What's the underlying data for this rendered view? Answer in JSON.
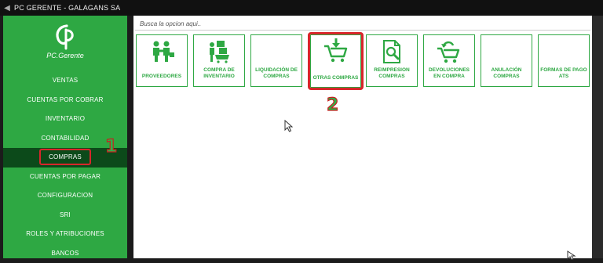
{
  "window": {
    "title": "PC GERENTE - GALAGANS SA"
  },
  "logo": {
    "text": "PC.Gerente"
  },
  "sidebar": {
    "items": [
      {
        "label": "VENTAS"
      },
      {
        "label": "CUENTAS POR COBRAR"
      },
      {
        "label": "INVENTARIO"
      },
      {
        "label": "CONTABILIDAD"
      },
      {
        "label": "COMPRAS"
      },
      {
        "label": "CUENTAS POR PAGAR"
      },
      {
        "label": "CONFIGURACION"
      },
      {
        "label": "SRI"
      },
      {
        "label": "ROLES Y ATRIBUCIONES"
      },
      {
        "label": "BANCOS"
      }
    ]
  },
  "search": {
    "placeholder": "Busca la opcion aqui.."
  },
  "tiles": [
    {
      "label": "PROVEEDORES",
      "icon": "suppliers-icon"
    },
    {
      "label": "COMPRA DE INVENTARIO",
      "icon": "inventory-purchase-icon"
    },
    {
      "label": "LIQUIDACIÓN DE COMPRAS",
      "icon": ""
    },
    {
      "label": "OTRAS COMPRAS",
      "icon": "shopping-cart-icon"
    },
    {
      "label": "REIMPRESION COMPRAS",
      "icon": "document-search-icon"
    },
    {
      "label": "DEVOLUCIONES EN COMPRA",
      "icon": "cart-return-icon"
    },
    {
      "label": "ANULACIÓN COMPRAS",
      "icon": ""
    },
    {
      "label": "FORMAS DE PAGO ATS",
      "icon": ""
    }
  ],
  "annotations": {
    "step1": "1",
    "step2": "2"
  },
  "colors": {
    "brand_green": "#2ea843",
    "highlight_red": "#d8262b",
    "active_nav": "#0c4a1a"
  }
}
